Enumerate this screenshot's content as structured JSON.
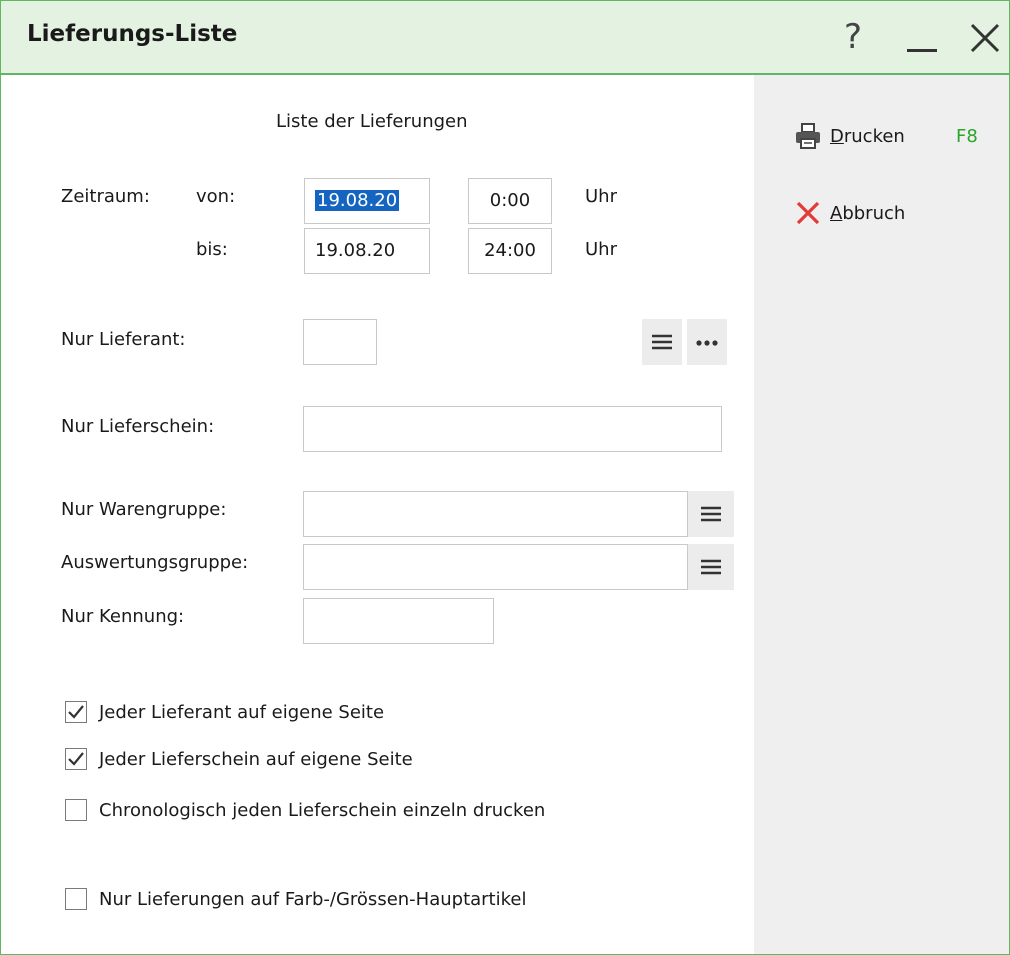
{
  "window": {
    "title": "Lieferungs-Liste",
    "help_symbol": "?"
  },
  "form": {
    "heading": "Liste der Lieferungen",
    "zeitraum_label": "Zeitraum:",
    "von_label": "von:",
    "bis_label": "bis:",
    "von_date": "19.08.20",
    "von_time": "0:00",
    "bis_date": "19.08.20",
    "bis_time": "24:00",
    "uhr_label": "Uhr",
    "lieferant_label": "Nur Lieferant:",
    "lieferant_value": "",
    "lieferschein_label": "Nur Lieferschein:",
    "lieferschein_value": "",
    "warengruppe_label": "Nur Warengruppe:",
    "warengruppe_value": "",
    "auswertung_label": "Auswertungsgruppe:",
    "auswertung_value": "",
    "kennung_label": "Nur Kennung:",
    "kennung_value": ""
  },
  "options": [
    {
      "label": "Jeder Lieferant auf eigene Seite",
      "checked": true
    },
    {
      "label": "Jeder Lieferschein auf eigene Seite",
      "checked": true
    },
    {
      "label": "Chronologisch jeden Lieferschein einzeln drucken",
      "checked": false
    },
    {
      "label": "Nur Lieferungen auf Farb-/Grössen-Hauptartikel",
      "checked": false
    }
  ],
  "actions": {
    "print_first": "D",
    "print_rest": "rucken",
    "print_key": "F8",
    "cancel_first": "A",
    "cancel_rest": "bbruch"
  },
  "icons": {
    "print": "printer-icon",
    "cancel": "close-x-icon",
    "list": "list-icon",
    "more": "ellipsis-icon"
  },
  "colors": {
    "accent": "#5fb85f",
    "titlebar_bg": "#e4f2e2",
    "selection": "#1565c0",
    "shortcut": "#2aa52a",
    "cancel": "#e53935"
  }
}
